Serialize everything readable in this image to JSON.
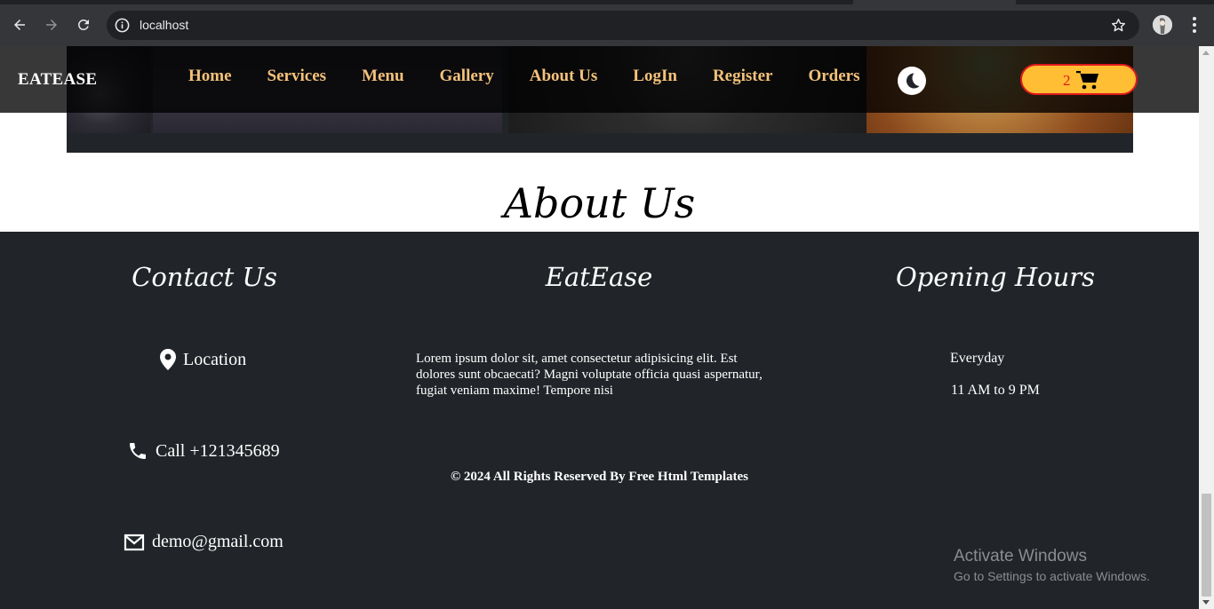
{
  "browser": {
    "url": "localhost"
  },
  "header": {
    "brand": "EATEASE",
    "nav": [
      "Home",
      "Services",
      "Menu",
      "Gallery",
      "About Us",
      "LogIn",
      "Register",
      "Orders"
    ],
    "cart_count": "2"
  },
  "about": {
    "heading": "About Us"
  },
  "footer": {
    "contact": {
      "heading": "Contact Us",
      "location": "Location",
      "call": "Call +121345689",
      "email": "demo@gmail.com"
    },
    "info": {
      "heading": "EatEase",
      "text": "Lorem ipsum dolor sit, amet consectetur adipisicing elit. Est dolores sunt obcaecati? Magni voluptate officia quasi aspernatur, fugiat veniam maxime! Tempore nisi"
    },
    "hours": {
      "heading": "Opening Hours",
      "days": "Everyday",
      "time": "11 AM to 9 PM"
    },
    "copyright": "© 2024 All Rights Reserved By Free Html Templates"
  },
  "watermark": {
    "title": "Activate Windows",
    "subtitle": "Go to Settings to activate Windows."
  },
  "colors": {
    "nav_link": "#f4c27a",
    "footer_bg": "#212529",
    "cart_bg": "#ffbe33",
    "cart_border": "#e0191d"
  }
}
